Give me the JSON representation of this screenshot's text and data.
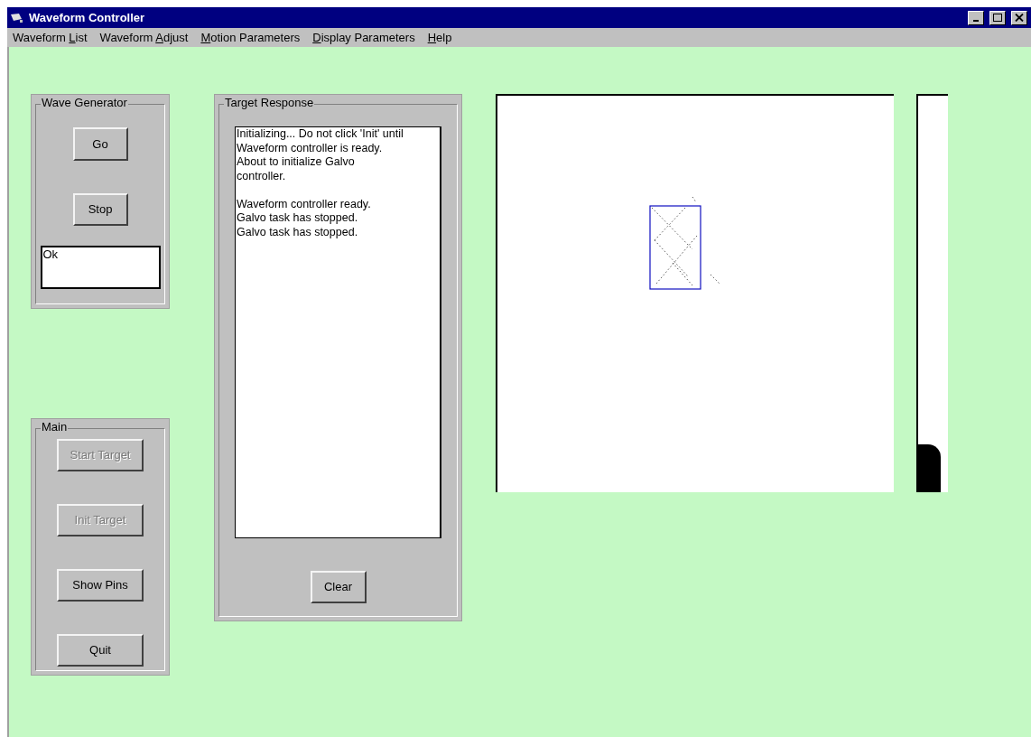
{
  "window": {
    "title": "Waveform Controller"
  },
  "menu": [
    {
      "before": "Waveform ",
      "key": "L",
      "after": "ist"
    },
    {
      "before": "Waveform ",
      "key": "A",
      "after": "djust"
    },
    {
      "key": "M",
      "after": "otion Parameters"
    },
    {
      "key": "D",
      "after": "isplay Parameters"
    },
    {
      "key": "H",
      "after": "elp"
    }
  ],
  "wave_generator": {
    "title": "Wave Generator",
    "buttons": [
      {
        "label": "Go",
        "disabled": false
      },
      {
        "label": "Stop",
        "disabled": false
      }
    ],
    "status": "Ok"
  },
  "main": {
    "title": "Main",
    "buttons": [
      {
        "label": "Start Target",
        "disabled": true
      },
      {
        "label": "Init Target",
        "disabled": true
      },
      {
        "label": "Show Pins",
        "disabled": false
      },
      {
        "label": "Quit",
        "disabled": false
      }
    ]
  },
  "target_response": {
    "title": "Target Response",
    "log": [
      {
        "text": "Initializing... Do not click 'Init' until",
        "gap_before": false
      },
      {
        "text": "Waveform controller is ready.",
        "gap_before": false
      },
      {
        "text": "About to initialize Galvo",
        "gap_before": false
      },
      {
        "text": "controller.",
        "gap_before": false
      },
      {
        "text": "Waveform controller ready.",
        "gap_before": true
      },
      {
        "text": "Galvo task has stopped.",
        "gap_before": false
      },
      {
        "text": "Galvo task has stopped.",
        "gap_before": false
      }
    ],
    "clear_button": "Clear"
  },
  "meter": {
    "level": 0.12
  }
}
